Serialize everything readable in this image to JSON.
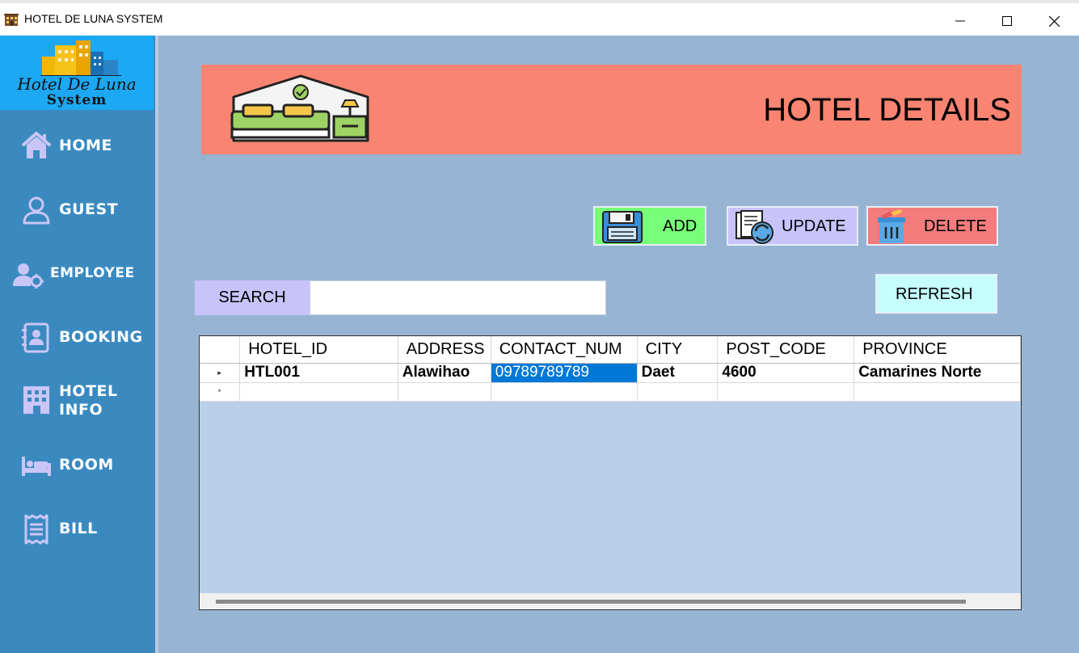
{
  "window": {
    "title": "HOTEL DE LUNA SYSTEM",
    "controls": {
      "minimize": "minimize-icon",
      "maximize": "maximize-icon",
      "close": "close-icon"
    }
  },
  "logo": {
    "line1": "Hotel De Luna",
    "line2": "System"
  },
  "sidebar": {
    "items": [
      {
        "label": "HOME",
        "icon": "home-icon"
      },
      {
        "label": "GUEST",
        "icon": "user-icon"
      },
      {
        "label": "EMPLOYEE",
        "icon": "employee-gear-icon"
      },
      {
        "label": "BOOKING",
        "icon": "contact-book-icon"
      },
      {
        "label": "HOTEL",
        "label2": "INFO",
        "icon": "hotel-building-icon"
      },
      {
        "label": "ROOM",
        "icon": "bed-icon"
      },
      {
        "label": "BILL",
        "icon": "receipt-icon"
      }
    ]
  },
  "banner": {
    "title": "HOTEL DETAILS",
    "icon": "hotel-room-bed-icon"
  },
  "actions": {
    "add": "ADD",
    "update": "UPDATE",
    "delete": "DELETE",
    "refresh": "REFRESH"
  },
  "search": {
    "label": "SEARCH",
    "value": ""
  },
  "grid": {
    "columns": [
      "HOTEL_ID",
      "ADDRESS",
      "CONTACT_NUM",
      "CITY",
      "POST_CODE",
      "PROVINCE"
    ],
    "rows": [
      [
        "HTL001",
        "Alawihao",
        "09789789789",
        "Daet",
        "4600",
        "Camarines Norte"
      ]
    ],
    "row_marker": "▸",
    "new_row_marker": "*"
  },
  "colors": {
    "sidebar": "#3a8ac0",
    "logo_bg": "#1ca8f2",
    "main_bg": "#98b4d3",
    "banner": "#fa8472",
    "add": "#78fe78",
    "update": "#c8c3fa",
    "delete": "#f47c7c",
    "refresh": "#c6fdfd",
    "selection": "#0078d7"
  }
}
